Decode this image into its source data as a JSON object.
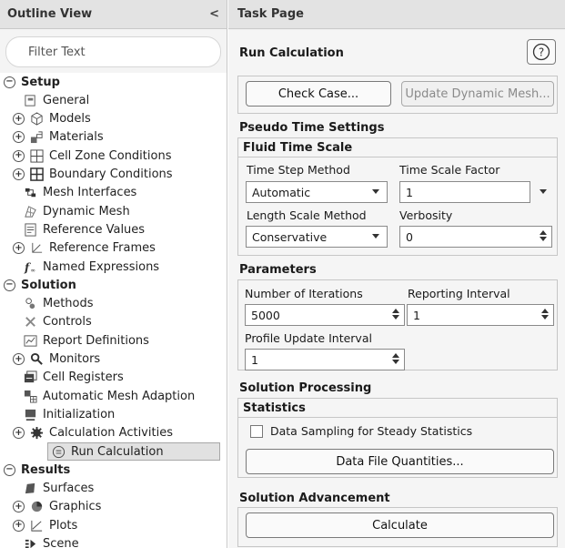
{
  "outline": {
    "title": "Outline View",
    "collapse_glyph": "<",
    "filter_placeholder": "Filter Text",
    "items": [
      {
        "label": "Setup",
        "kind": "section",
        "expander": "−"
      },
      {
        "label": "General",
        "icon": "general-icon"
      },
      {
        "label": "Models",
        "icon": "models-icon",
        "expander": "+"
      },
      {
        "label": "Materials",
        "icon": "materials-icon",
        "expander": "+"
      },
      {
        "label": "Cell Zone Conditions",
        "icon": "cell-zone-icon",
        "expander": "+"
      },
      {
        "label": "Boundary Conditions",
        "icon": "boundary-icon",
        "expander": "+"
      },
      {
        "label": "Mesh Interfaces",
        "icon": "mesh-interfaces-icon"
      },
      {
        "label": "Dynamic Mesh",
        "icon": "dynamic-mesh-icon"
      },
      {
        "label": "Reference Values",
        "icon": "reference-values-icon"
      },
      {
        "label": "Reference Frames",
        "icon": "reference-frames-icon",
        "expander": "+"
      },
      {
        "label": "Named Expressions",
        "icon": "function-icon"
      },
      {
        "label": "Solution",
        "kind": "section",
        "expander": "−"
      },
      {
        "label": "Methods",
        "icon": "methods-icon"
      },
      {
        "label": "Controls",
        "icon": "controls-icon"
      },
      {
        "label": "Report Definitions",
        "icon": "report-definitions-icon"
      },
      {
        "label": "Monitors",
        "icon": "monitors-icon",
        "expander": "+"
      },
      {
        "label": "Cell Registers",
        "icon": "cell-registers-icon"
      },
      {
        "label": "Automatic Mesh Adaption",
        "icon": "mesh-adaption-icon"
      },
      {
        "label": "Initialization",
        "icon": "initialization-icon"
      },
      {
        "label": "Calculation Activities",
        "icon": "calculation-activities-icon",
        "expander": "+"
      },
      {
        "label": "Run Calculation",
        "icon": "run-calculation-icon",
        "selected": true
      },
      {
        "label": "Results",
        "kind": "section",
        "expander": "−"
      },
      {
        "label": "Surfaces",
        "icon": "surfaces-icon"
      },
      {
        "label": "Graphics",
        "icon": "graphics-icon",
        "expander": "+"
      },
      {
        "label": "Plots",
        "icon": "plots-icon",
        "expander": "+"
      },
      {
        "label": "Scene",
        "icon": "scene-icon"
      }
    ]
  },
  "task": {
    "title": "Task Page",
    "run_calculation": "Run Calculation",
    "help_glyph": "?",
    "check_case": "Check Case...",
    "update_dynamic_mesh": "Update Dynamic Mesh...",
    "pseudo_time_settings": "Pseudo Time Settings",
    "fluid_time_scale": "Fluid Time Scale",
    "time_step_method_label": "Time Step Method",
    "time_step_method_value": "Automatic",
    "time_scale_factor_label": "Time Scale Factor",
    "time_scale_factor_value": "1",
    "length_scale_method_label": "Length Scale Method",
    "length_scale_method_value": "Conservative",
    "verbosity_label": "Verbosity",
    "verbosity_value": "0",
    "parameters": "Parameters",
    "number_of_iterations_label": "Number of Iterations",
    "number_of_iterations_value": "5000",
    "reporting_interval_label": "Reporting Interval",
    "reporting_interval_value": "1",
    "profile_update_interval_label": "Profile Update Interval",
    "profile_update_interval_value": "1",
    "solution_processing": "Solution Processing",
    "statistics": "Statistics",
    "data_sampling_label": "Data Sampling for Steady Statistics",
    "data_sampling_checked": false,
    "data_file_quantities": "Data File Quantities...",
    "solution_advancement": "Solution Advancement",
    "calculate": "Calculate"
  }
}
